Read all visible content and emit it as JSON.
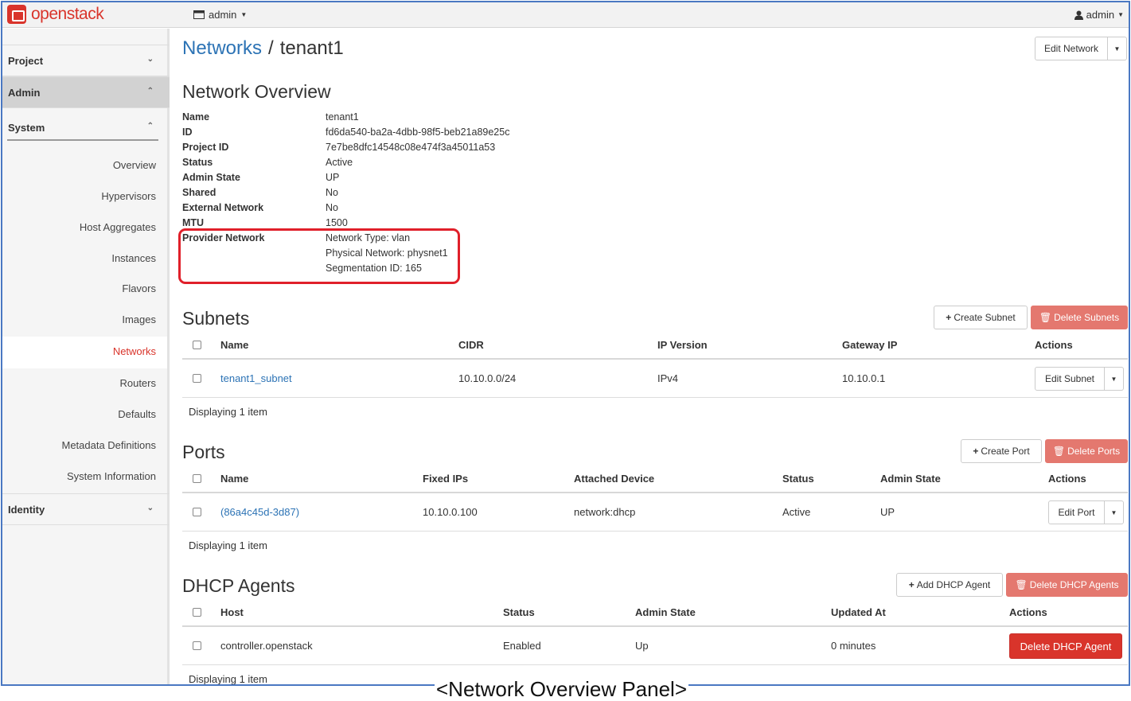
{
  "topbar": {
    "logo_text": "openstack",
    "project_menu": "admin",
    "user_menu": "admin"
  },
  "sidebar": {
    "project": "Project",
    "admin": "Admin",
    "system": "System",
    "items": [
      "Overview",
      "Hypervisors",
      "Host Aggregates",
      "Instances",
      "Flavors",
      "Images",
      "Networks",
      "Routers",
      "Defaults",
      "Metadata Definitions",
      "System Information"
    ],
    "active_item": "Networks",
    "identity": "Identity"
  },
  "breadcrumb": {
    "parent": "Networks",
    "sep": "/",
    "current": "tenant1"
  },
  "edit_network_label": "Edit Network",
  "overview": {
    "title": "Network Overview",
    "rows": [
      {
        "label": "Name",
        "value": "tenant1"
      },
      {
        "label": "ID",
        "value": "fd6da540-ba2a-4dbb-98f5-beb21a89e25c"
      },
      {
        "label": "Project ID",
        "value": "7e7be8dfc14548c08e474f3a45011a53"
      },
      {
        "label": "Status",
        "value": "Active"
      },
      {
        "label": "Admin State",
        "value": "UP"
      },
      {
        "label": "Shared",
        "value": "No"
      },
      {
        "label": "External Network",
        "value": "No"
      },
      {
        "label": "MTU",
        "value": "1500"
      }
    ],
    "provider_label": "Provider Network",
    "provider_lines": [
      "Network Type: vlan",
      "Physical Network: physnet1",
      "Segmentation ID: 165"
    ]
  },
  "subnets": {
    "title": "Subnets",
    "create_label": "Create Subnet",
    "delete_label": "Delete Subnets",
    "headers": [
      "Name",
      "CIDR",
      "IP Version",
      "Gateway IP",
      "Actions"
    ],
    "rows": [
      {
        "name": "tenant1_subnet",
        "cidr": "10.10.0.0/24",
        "ip_version": "IPv4",
        "gateway": "10.10.0.1",
        "action": "Edit Subnet"
      }
    ],
    "footer": "Displaying 1 item"
  },
  "ports": {
    "title": "Ports",
    "create_label": "Create Port",
    "delete_label": "Delete Ports",
    "headers": [
      "Name",
      "Fixed IPs",
      "Attached Device",
      "Status",
      "Admin State",
      "Actions"
    ],
    "rows": [
      {
        "name": "(86a4c45d-3d87)",
        "fixed_ips": "10.10.0.100",
        "device": "network:dhcp",
        "status": "Active",
        "admin_state": "UP",
        "action": "Edit Port"
      }
    ],
    "footer": "Displaying 1 item"
  },
  "dhcp": {
    "title": "DHCP Agents",
    "add_label": "Add DHCP Agent",
    "delete_label": "Delete DHCP Agents",
    "headers": [
      "Host",
      "Status",
      "Admin State",
      "Updated At",
      "Actions"
    ],
    "rows": [
      {
        "host": "controller.openstack",
        "status": "Enabled",
        "admin_state": "Up",
        "updated": "0 minutes",
        "action": "Delete DHCP Agent"
      }
    ],
    "footer": "Displaying 1 item"
  },
  "caption": "<Network Overview Panel>"
}
